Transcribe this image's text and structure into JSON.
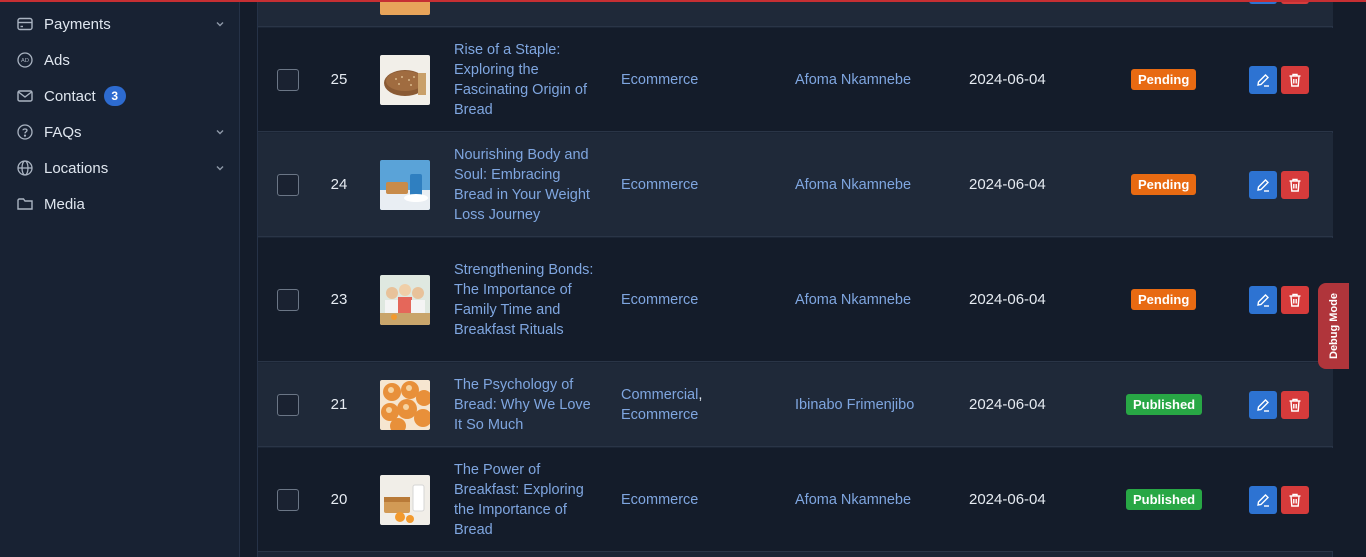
{
  "sidebar": {
    "items": [
      {
        "label": "Payments",
        "icon": "credit-card-icon",
        "has_submenu": true
      },
      {
        "label": "Ads",
        "icon": "ad-badge-icon",
        "has_submenu": false
      },
      {
        "label": "Contact",
        "icon": "mail-icon",
        "badge": "3",
        "has_submenu": false
      },
      {
        "label": "FAQs",
        "icon": "question-circle-icon",
        "has_submenu": true
      },
      {
        "label": "Locations",
        "icon": "globe-icon",
        "has_submenu": true
      },
      {
        "label": "Media",
        "icon": "folder-icon",
        "has_submenu": false
      }
    ]
  },
  "posts": {
    "rows": [
      {
        "id": "25",
        "title": "Rise of a Staple: Exploring the Fascinating Origin of Bread",
        "categories": [
          "Ecommerce"
        ],
        "author": "Afoma Nkamnebe",
        "date": "2024-06-04",
        "status": "Pending",
        "thumb": "bread-loaf"
      },
      {
        "id": "24",
        "title": "Nourishing Body and Soul: Embracing Bread in Your Weight Loss Journey",
        "categories": [
          "Ecommerce"
        ],
        "author": "Afoma Nkamnebe",
        "date": "2024-06-04",
        "status": "Pending",
        "thumb": "scale-bread"
      },
      {
        "id": "23",
        "title": "Strengthening Bonds: The Importance of Family Time and Breakfast Rituals",
        "categories": [
          "Ecommerce"
        ],
        "author": "Afoma Nkamnebe",
        "date": "2024-06-04",
        "status": "Pending",
        "thumb": "family"
      },
      {
        "id": "21",
        "title": "The Psychology of Bread: Why We Love It So Much",
        "categories": [
          "Commercial",
          "Ecommerce"
        ],
        "author": "Ibinabo Frimenjibo",
        "date": "2024-06-04",
        "status": "Published",
        "thumb": "buns"
      },
      {
        "id": "20",
        "title": "The Power of Breakfast: Exploring the Importance of Bread",
        "categories": [
          "Ecommerce"
        ],
        "author": "Afoma Nkamnebe",
        "date": "2024-06-04",
        "status": "Published",
        "thumb": "breakfast"
      }
    ]
  },
  "debug": {
    "label": "Debug Mode"
  },
  "colors": {
    "link": "#7fa6e0",
    "pending": "#e86a12",
    "published": "#28a745",
    "edit": "#2d73d2",
    "delete": "#d63b3b"
  }
}
